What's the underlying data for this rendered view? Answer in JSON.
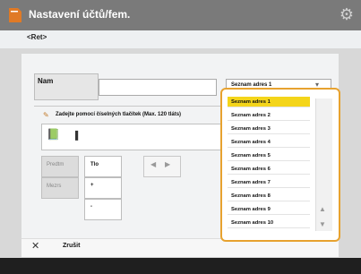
{
  "titlebar": {
    "title": "Nastavení účtů/fem.",
    "gear_icon": "gear-icon"
  },
  "subtitle": "<Ret>",
  "form": {
    "name_label": "Nam",
    "name_hint": "",
    "name_value": "",
    "list_select_value": "Seznam adres 1",
    "tree_label": "Zadejte pomocí číselných tlačítek (Max. 120 tláts)",
    "entry_text": "▌",
    "buttons": {
      "predtch": "Predtm",
      "tlo": "Tlo",
      "more": "Mezrs",
      "plus": "+",
      "minus": "-"
    },
    "nav_left": "◀",
    "nav_right": "▶"
  },
  "dropdown": {
    "items": [
      "Seznam adres 1",
      "Seznam adres 2",
      "Seznam adres 3",
      "Seznam adres 4",
      "Seznam adres 5",
      "Seznam adres 6",
      "Seznam adres 7",
      "Seznam adres 8",
      "Seznam adres 9",
      "Seznam adres 10"
    ],
    "selected_index": 0,
    "scroll_up": "▲",
    "scroll_down": "▼"
  },
  "footer": {
    "cancel_icon": "close-icon",
    "cancel_label": "Zrušit"
  }
}
